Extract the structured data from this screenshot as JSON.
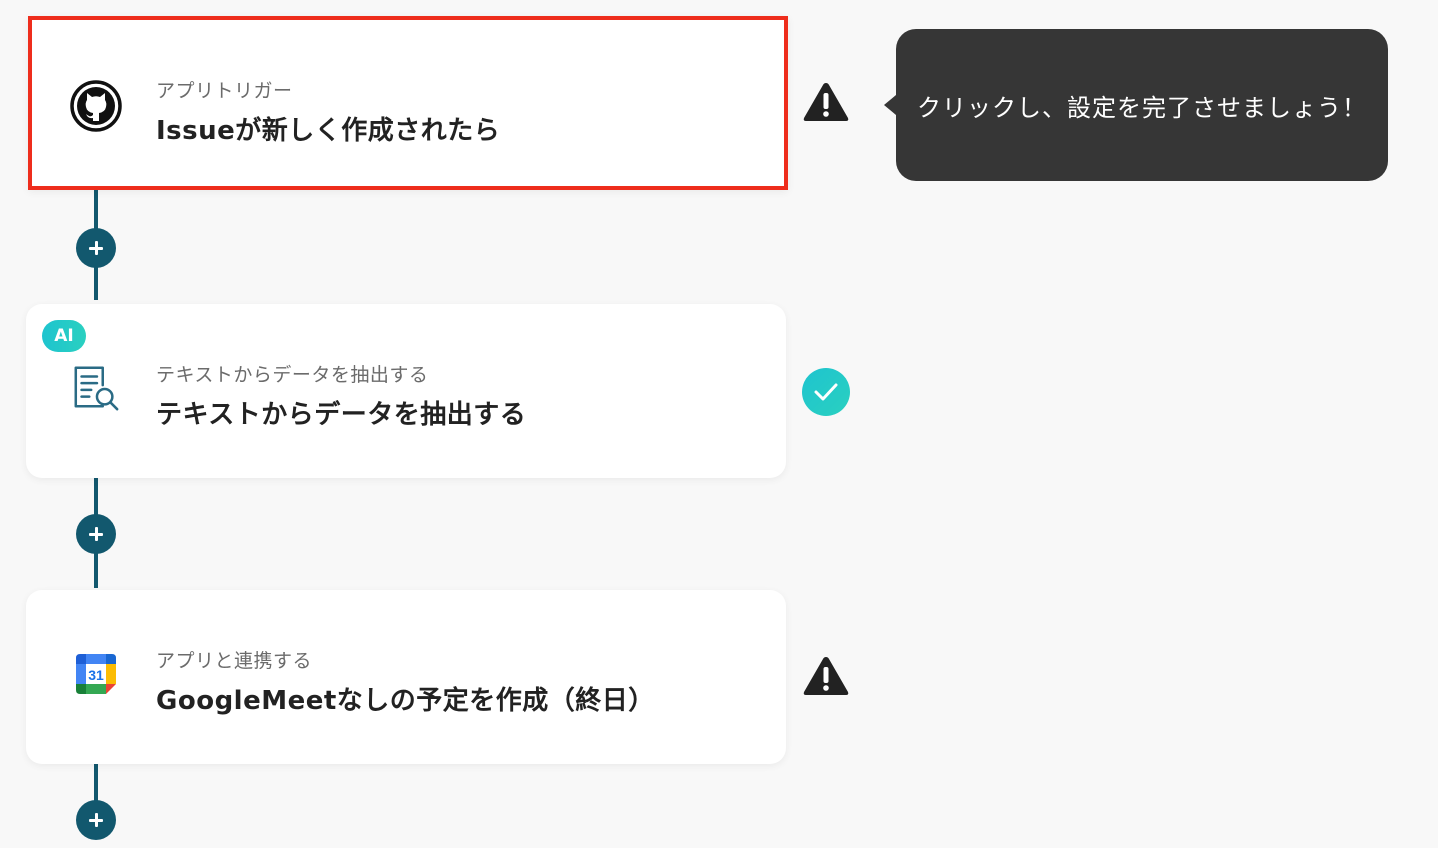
{
  "flow": {
    "steps": [
      {
        "subtitle": "アプリトリガー",
        "title": "Issueが新しく作成されたら",
        "icon": "github-icon",
        "status": "warning",
        "selected": true
      },
      {
        "badge": "AI",
        "subtitle": "テキストからデータを抽出する",
        "title": "テキストからデータを抽出する",
        "icon": "document-search-icon",
        "status": "complete"
      },
      {
        "subtitle": "アプリと連携する",
        "title": "GoogleMeetなしの予定を作成（終日）",
        "icon": "google-calendar-icon",
        "calendar_day": "31",
        "status": "warning"
      }
    ]
  },
  "tooltip": {
    "text": "クリックし、設定を完了させましょう！"
  },
  "colors": {
    "connector": "#12586e",
    "selected_border": "#ee2d1c",
    "complete": "#1ec4cf",
    "warning": "#222222",
    "tooltip_bg": "#363636"
  }
}
